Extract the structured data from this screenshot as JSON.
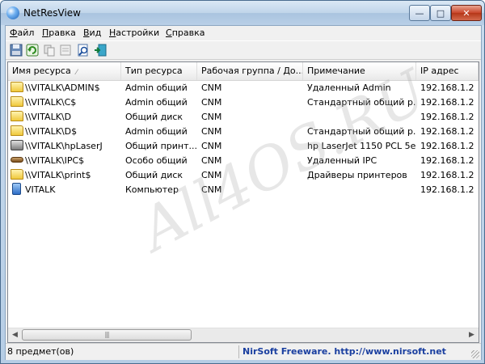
{
  "window": {
    "title": "NetResView"
  },
  "menu": [
    {
      "accel": "Ф",
      "rest": "айл"
    },
    {
      "accel": "П",
      "rest": "равка"
    },
    {
      "accel": "В",
      "rest": "ид"
    },
    {
      "accel": "Н",
      "rest": "астройки"
    },
    {
      "accel": "С",
      "rest": "правка"
    }
  ],
  "columns": [
    "Имя ресурса",
    "Тип ресурса",
    "Рабочая группа / До...",
    "Примечание",
    "IP адрес"
  ],
  "rows": [
    {
      "icon": "folder",
      "name": "\\\\VITALK\\ADMIN$",
      "type": "Admin общий",
      "group": "CNM",
      "note": "Удаленный Admin",
      "ip": "192.168.1.2"
    },
    {
      "icon": "folder",
      "name": "\\\\VITALK\\C$",
      "type": "Admin общий",
      "group": "CNM",
      "note": "Стандартный общий р...",
      "ip": "192.168.1.2"
    },
    {
      "icon": "folder",
      "name": "\\\\VITALK\\D",
      "type": "Общий диск",
      "group": "CNM",
      "note": "",
      "ip": "192.168.1.2"
    },
    {
      "icon": "folder",
      "name": "\\\\VITALK\\D$",
      "type": "Admin общий",
      "group": "CNM",
      "note": "Стандартный общий р...",
      "ip": "192.168.1.2"
    },
    {
      "icon": "printer",
      "name": "\\\\VITALK\\hpLaserJ",
      "type": "Общий принт...",
      "group": "CNM",
      "note": "hp LaserJet 1150 PCL 5e",
      "ip": "192.168.1.2"
    },
    {
      "icon": "ipc",
      "name": "\\\\VITALK\\IPC$",
      "type": "Особо общий",
      "group": "CNM",
      "note": "Удаленный IPC",
      "ip": "192.168.1.2"
    },
    {
      "icon": "folder",
      "name": "\\\\VITALK\\print$",
      "type": "Общий диск",
      "group": "CNM",
      "note": "Драйверы принтеров",
      "ip": "192.168.1.2"
    },
    {
      "icon": "computer",
      "name": "VITALK",
      "type": "Компьютер",
      "group": "CNM",
      "note": "",
      "ip": "192.168.1.2"
    }
  ],
  "watermark": "All4OS.RU",
  "status": {
    "count": "8 предмет(ов)",
    "nirsoft": "NirSoft Freeware.  http://www.nirsoft.net"
  },
  "colors": {
    "title_bar": "#c0d5ea",
    "close_button": "#c9452a",
    "status_link": "#1a3fa0"
  }
}
